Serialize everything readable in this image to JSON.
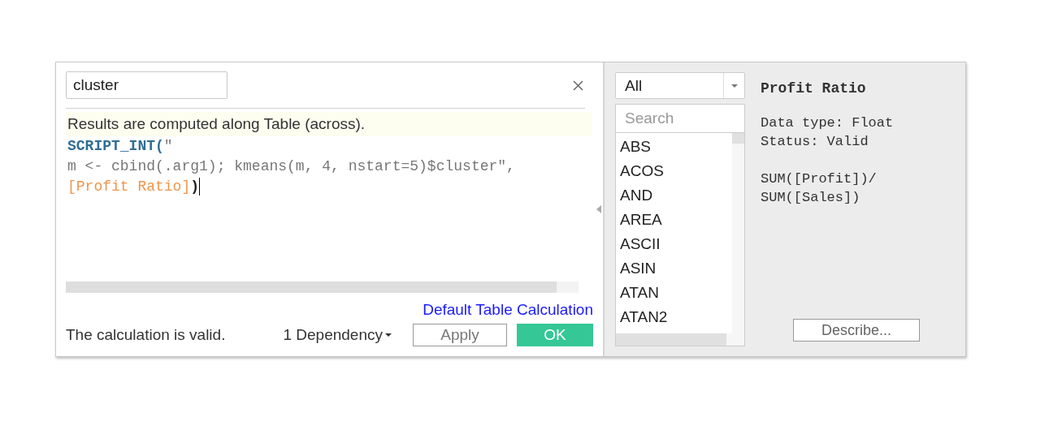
{
  "calc_name": {
    "value": "cluster"
  },
  "notice": "Results are computed along Table (across).",
  "code_lines": [
    [
      {
        "kind": "keyword",
        "text": "SCRIPT_INT("
      },
      {
        "kind": "string",
        "text": "\""
      }
    ],
    [
      {
        "kind": "string",
        "text": "m <- cbind(.arg1); kmeans(m, 4, nstart=5)$cluster\","
      }
    ],
    [
      {
        "kind": "field",
        "text": "[Profit Ratio]"
      },
      {
        "kind": "punct",
        "text": ")"
      }
    ]
  ],
  "default_link": "Default Table Calculation",
  "status": "The calculation is valid.",
  "dependency": "1 Dependency",
  "buttons": [
    {
      "label": "Apply",
      "kind": "secondary"
    },
    {
      "label": "OK",
      "kind": "primary"
    }
  ],
  "category": {
    "value": "All"
  },
  "function_search": {
    "placeholder": "Search"
  },
  "functions": [
    "ABS",
    "ACOS",
    "AND",
    "AREA",
    "ASCII",
    "ASIN",
    "ATAN",
    "ATAN2"
  ],
  "details": {
    "title": "Profit Ratio",
    "lines": [
      "Data type: Float",
      "Status: Valid"
    ],
    "formula": [
      "SUM([Profit])/",
      "SUM([Sales])"
    ]
  },
  "describe_button": "Describe..."
}
